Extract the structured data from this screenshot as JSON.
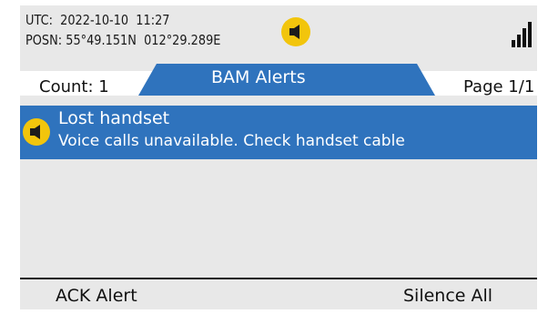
{
  "status": {
    "utc_label": "UTC:",
    "utc_value": "2022-10-10  11:27",
    "posn_label": "POSN:",
    "posn_value": "55°49.151N  012°29.289E"
  },
  "icons": {
    "alarm": "speaker-alarm-icon",
    "signal": "signal-strength-icon"
  },
  "tabs": {
    "count_label": "Count: 1",
    "title": "BAM Alerts",
    "page_label": "Page 1/1"
  },
  "alerts": [
    {
      "title": "Lost handset",
      "description": "Voice calls unavailable. Check handset cable"
    }
  ],
  "softkeys": {
    "left": "ACK Alert",
    "right": "Silence All"
  },
  "colors": {
    "accent": "#2f73bd",
    "alarm": "#f2c50c",
    "panel": "#e8e8e8"
  }
}
